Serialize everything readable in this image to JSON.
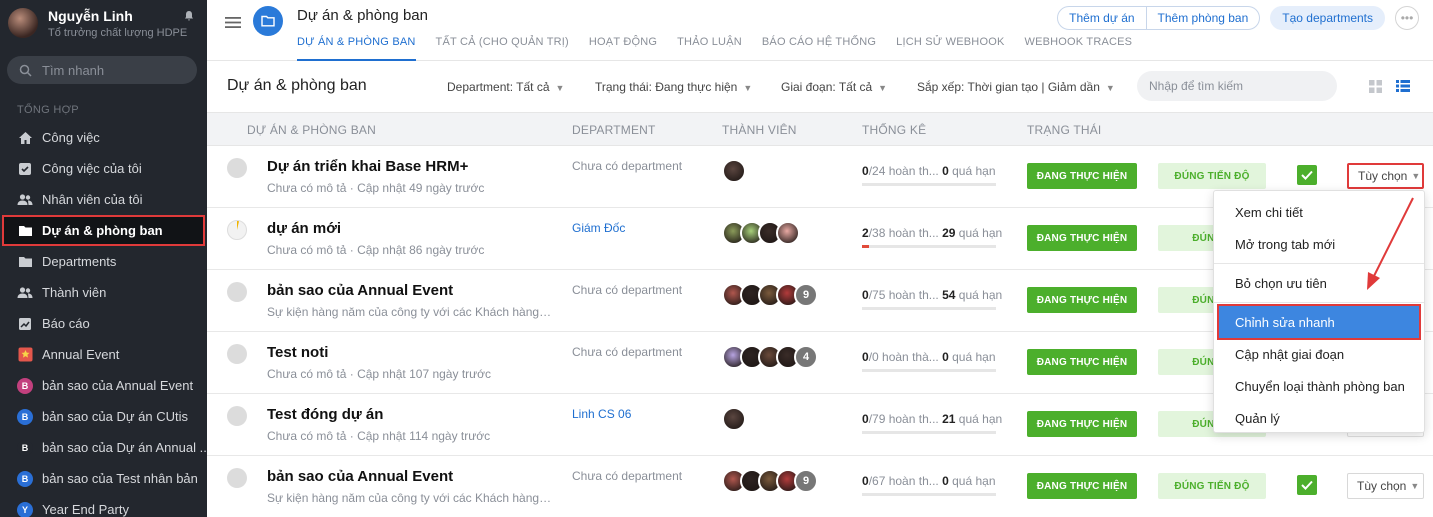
{
  "user": {
    "name": "Nguyễn Linh",
    "role": "Tổ trưởng chất lượng HDPE"
  },
  "sidebar": {
    "search_placeholder": "Tìm nhanh",
    "section": "TỔNG HỢP",
    "items": [
      {
        "label": "Công việc",
        "icon": "home-icon"
      },
      {
        "label": "Công việc của tôi",
        "icon": "checkbox-icon"
      },
      {
        "label": "Nhân viên của tôi",
        "icon": "users-icon"
      },
      {
        "label": "Dự án & phòng ban",
        "icon": "folder-icon",
        "active": true
      },
      {
        "label": "Departments",
        "icon": "folder-icon"
      },
      {
        "label": "Thành viên",
        "icon": "users-icon"
      },
      {
        "label": "Báo cáo",
        "icon": "chart-icon"
      },
      {
        "label": "Annual Event",
        "icon": "star-badge-icon"
      },
      {
        "label": "bản sao của Annual Event",
        "letter": "B",
        "color": "#c2407e"
      },
      {
        "label": "bản sao của Dự án CUtis",
        "letter": "B",
        "color": "#2a6fd6"
      },
      {
        "label": "bản sao của Dự án Annual ...",
        "letter": "B",
        "color": "#23272e"
      },
      {
        "label": "bản sao của Test nhân bản",
        "letter": "B",
        "color": "#2a6fd6"
      },
      {
        "label": "Year End Party",
        "letter": "Y",
        "color": "#2a6fd6"
      }
    ]
  },
  "header": {
    "title": "Dự án & phòng ban",
    "tabs": [
      "DỰ ÁN & PHÒNG BAN",
      "TẤT CẢ (CHO QUẢN TRỊ)",
      "HOẠT ĐỘNG",
      "THẢO LUẬN",
      "BÁO CÁO HỆ THỐNG",
      "LỊCH SỬ WEBHOOK",
      "WEBHOOK TRACES"
    ],
    "btn_add_project": "Thêm dự án",
    "btn_add_dept": "Thêm phòng ban",
    "btn_create_depts": "Tạo departments"
  },
  "filters": {
    "title": "Dự án & phòng ban",
    "department": "Department: Tất cả",
    "status": "Trạng thái: Đang thực hiện",
    "stage": "Giai đoạn: Tất cả",
    "sort": "Sắp xếp: Thời gian tạo | Giảm dần",
    "search_placeholder": "Nhập để tìm kiếm"
  },
  "columns": [
    "DỰ ÁN & PHÒNG BAN",
    "DEPARTMENT",
    "THÀNH VIÊN",
    "THỐNG KÊ",
    "TRẠNG THÁI"
  ],
  "rows": [
    {
      "title": "Dự án triển khai Base HRM+",
      "desc": "Chưa có mô tả · Cập nhật 49 ngày trước",
      "dept": "Chưa có department",
      "dept_link": false,
      "done": "0",
      "total": "/24",
      "done_label": " hoàn th...",
      "overdue": "0",
      "overdue_label": " quá hạn",
      "progress": 0,
      "status": "ĐANG THỰC HIỆN",
      "pace": "ĐÚNG TIẾN ĐỘ",
      "option": "Tùy chọn",
      "members": [
        "#5b4640"
      ],
      "extra": ""
    },
    {
      "title": "dự án mới",
      "desc": "Chưa có mô tả · Cập nhật 86 ngày trước",
      "dept": "Giám Đốc",
      "dept_link": true,
      "done": "2",
      "total": "/38",
      "done_label": " hoàn th...",
      "overdue": "29",
      "overdue_label": " quá hạn",
      "progress": 0.05,
      "status": "ĐANG THỰC HIỆN",
      "pace": "ĐÚNG T",
      "option": "",
      "members": [
        "#8a9b5a",
        "#a7d07a",
        "#3a2c28",
        "#e8a9a3"
      ],
      "extra": ""
    },
    {
      "title": "bản sao của Annual Event",
      "desc": "Sự kiện hàng năm của công ty với các Khách hàng, ...",
      "dept": "Chưa có department",
      "dept_link": false,
      "done": "0",
      "total": "/75",
      "done_label": " hoàn th...",
      "overdue": "54",
      "overdue_label": " quá hạn",
      "progress": 0,
      "status": "ĐANG THỰC HIỆN",
      "pace": "ĐÚNG T",
      "option": "",
      "members": [
        "#b0574e",
        "#2e2422",
        "#7a5a3c",
        "#b23b3b"
      ],
      "extra": "9"
    },
    {
      "title": "Test noti",
      "desc": "Chưa có mô tả · Cập nhật 107 ngày trước",
      "dept": "Chưa có department",
      "dept_link": false,
      "done": "0",
      "total": "/0",
      "done_label": " hoàn thà...",
      "overdue": "0",
      "overdue_label": " quá hạn",
      "progress": 0,
      "status": "ĐANG THỰC HIỆN",
      "pace": "ĐÚNG T",
      "option": "",
      "members": [
        "#b7a3e0",
        "#2e2422",
        "#6a4a3a",
        "#3a2c28"
      ],
      "extra": "4"
    },
    {
      "title": "Test đóng dự án",
      "desc": "Chưa có mô tả · Cập nhật 114 ngày trước",
      "dept": "Linh CS 06",
      "dept_link": true,
      "done": "0",
      "total": "/79",
      "done_label": " hoàn th...",
      "overdue": "21",
      "overdue_label": " quá hạn",
      "progress": 0,
      "status": "ĐANG THỰC HIỆN",
      "pace": "ĐÚNG T",
      "option": "",
      "members": [
        "#5b4640"
      ],
      "extra": ""
    },
    {
      "title": "bản sao của Annual Event",
      "desc": "Sự kiện hàng năm của công ty với các Khách hàng, ...",
      "dept": "Chưa có department",
      "dept_link": false,
      "done": "0",
      "total": "/67",
      "done_label": " hoàn th...",
      "overdue": "0",
      "overdue_label": " quá hạn",
      "progress": 0,
      "status": "ĐANG THỰC HIỆN",
      "pace": "ĐÚNG TIẾN ĐỘ",
      "option": "Tùy chọn",
      "members": [
        "#b0574e",
        "#2e2422",
        "#7a5a3c",
        "#b23b3b"
      ],
      "extra": "9"
    }
  ],
  "menu": {
    "items": [
      "Xem chi tiết",
      "Mở trong tab mới",
      "Bỏ chọn ưu tiên",
      "Chỉnh sửa nhanh",
      "Cập nhật giai đoạn",
      "Chuyển loại thành phòng ban",
      "Quản lý"
    ],
    "highlighted": "Chỉnh sửa nhanh"
  },
  "colors": {
    "sidebar_bg": "#23272e",
    "accent": "#1f6fd0",
    "green": "#4caf2c",
    "highlight_red": "#e03a3a"
  }
}
